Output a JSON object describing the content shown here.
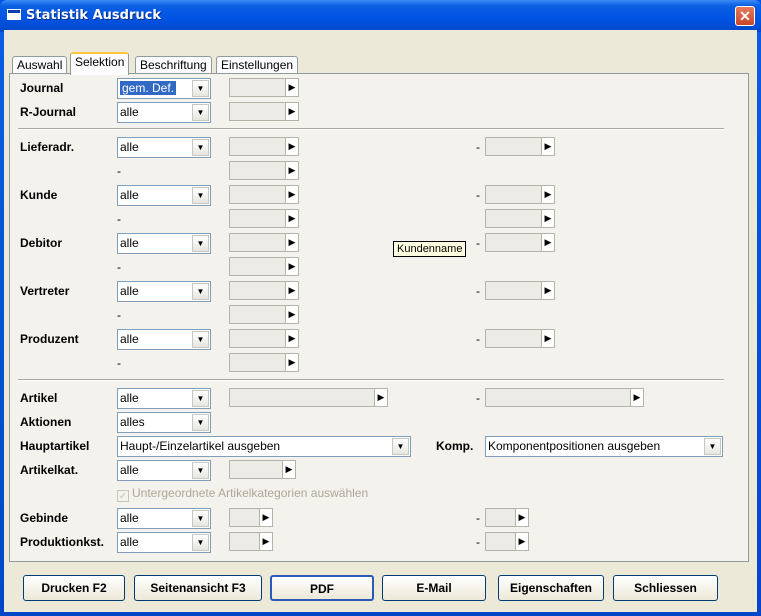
{
  "window": {
    "title": "Statistik Ausdruck",
    "close_symbol": "✕"
  },
  "tabs": [
    "Auswahl",
    "Selektion",
    "Beschriftung",
    "Einstellungen"
  ],
  "rows": {
    "journal": {
      "label": "Journal",
      "value": "gem. Def."
    },
    "r_journal": {
      "label": "R-Journal",
      "value": "alle"
    },
    "lieferadr": {
      "label": "Lieferadr.",
      "value": "alle"
    },
    "kunde": {
      "label": "Kunde",
      "value": "alle"
    },
    "debitor": {
      "label": "Debitor",
      "value": "alle"
    },
    "vertreter": {
      "label": "Vertreter",
      "value": "alle"
    },
    "produzent": {
      "label": "Produzent",
      "value": "alle"
    },
    "artikel": {
      "label": "Artikel",
      "value": "alle"
    },
    "aktionen": {
      "label": "Aktionen",
      "value": "alles"
    },
    "hauptartikel": {
      "label": "Hauptartikel",
      "value": "Haupt-/Einzelartikel ausgeben"
    },
    "komp": {
      "label": "Komp.",
      "value": "Komponentpositionen ausgeben"
    },
    "artikelkat": {
      "label": "Artikelkat.",
      "value": "alle"
    },
    "gebinde": {
      "label": "Gebinde",
      "value": "alle"
    },
    "produktionskst": {
      "label": "Produktionkst.",
      "value": "alle"
    }
  },
  "dash": "-",
  "tooltip": "Kundenname",
  "checkbox": {
    "label": "Untergeordnete Artikelkategorien auswählen",
    "checked": true,
    "enabled": false
  },
  "buttons": [
    "Drucken F2",
    "Seitenansicht F3",
    "PDF",
    "E-Mail",
    "Eigenschaften",
    "Schliessen"
  ],
  "icons": {
    "dropdown": "chevron-down-icon",
    "arrow": "arrow-right-icon"
  }
}
